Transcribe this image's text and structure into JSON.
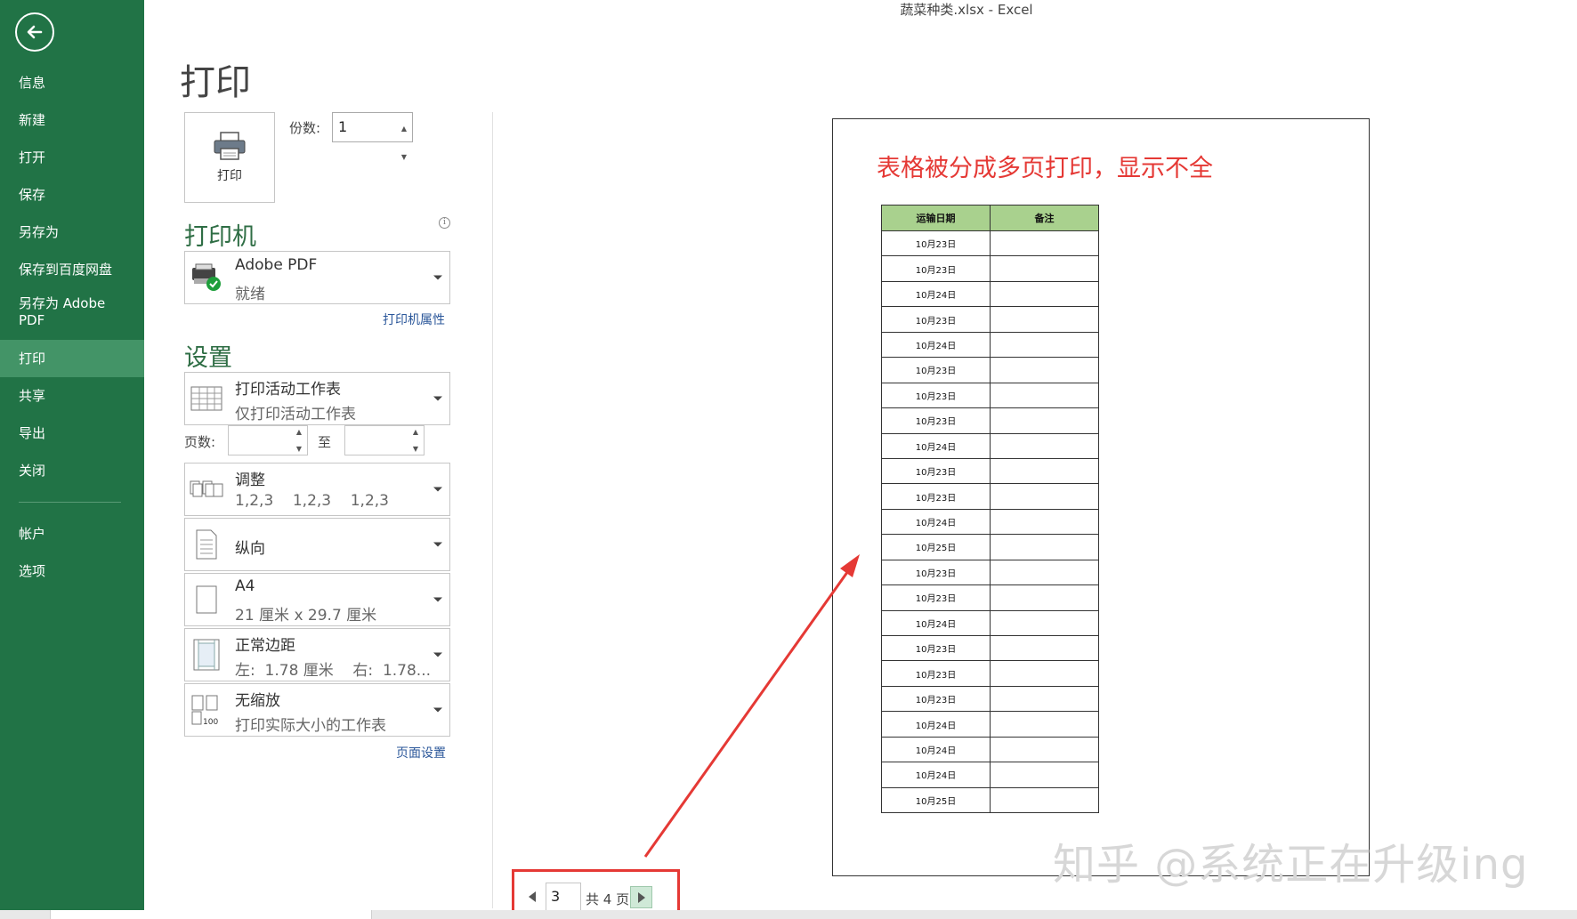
{
  "window": {
    "title": "蔬菜种类.xlsx - Excel"
  },
  "sidebar": {
    "items": [
      {
        "label": "信息"
      },
      {
        "label": "新建"
      },
      {
        "label": "打开"
      },
      {
        "label": "保存"
      },
      {
        "label": "另存为"
      },
      {
        "label": "保存到百度网盘"
      },
      {
        "label": "另存为 Adobe PDF"
      },
      {
        "label": "打印",
        "active": true
      },
      {
        "label": "共享"
      },
      {
        "label": "导出"
      },
      {
        "label": "关闭"
      }
    ],
    "bottom_items": [
      {
        "label": "帐户"
      },
      {
        "label": "选项"
      }
    ]
  },
  "print": {
    "title": "打印",
    "print_button_label": "打印",
    "copies_label": "份数:",
    "copies_value": "1",
    "printer_heading": "打印机",
    "printer_name": "Adobe PDF",
    "printer_status": "就绪",
    "printer_properties_link": "打印机属性",
    "settings_heading": "设置",
    "scope_main": "打印活动工作表",
    "scope_sub": "仅打印活动工作表",
    "pages_label": "页数:",
    "pages_to": "至",
    "collate_main": "调整",
    "collate_sub": "1,2,3    1,2,3    1,2,3",
    "orientation": "纵向",
    "paper_main": "A4",
    "paper_sub": "21 厘米 x 29.7 厘米",
    "margins_main": "正常边距",
    "margins_sub": "左:  1.78 厘米    右:  1.78...",
    "scaling_main": "无缩放",
    "scaling_sub": "打印实际大小的工作表",
    "scaling_icon_text": "100",
    "page_setup_link": "页面设置"
  },
  "preview": {
    "annotation": "表格被分成多页打印，显示不全",
    "table": {
      "headers": [
        "运输日期",
        "备注"
      ],
      "rows": [
        "10月23日",
        "10月23日",
        "10月24日",
        "10月23日",
        "10月24日",
        "10月23日",
        "10月23日",
        "10月23日",
        "10月24日",
        "10月23日",
        "10月23日",
        "10月24日",
        "10月25日",
        "10月23日",
        "10月23日",
        "10月24日",
        "10月23日",
        "10月23日",
        "10月23日",
        "10月24日",
        "10月24日",
        "10月24日",
        "10月25日"
      ]
    },
    "pager": {
      "current": "3",
      "total_text": "共 4 页"
    },
    "watermark": "知乎 @系统正在升级ing"
  },
  "colors": {
    "sidebar_bg": "#217346",
    "sidebar_active": "#439467",
    "section_heading": "#2f6e45",
    "annotation_red": "#e53935",
    "table_header_bg": "#a9d18e",
    "link": "#2b579a"
  },
  "icons": [
    "back-arrow-icon",
    "printer-icon",
    "printer-device-icon",
    "ready-check-icon",
    "sheet-icon",
    "collate-icon",
    "portrait-icon",
    "paper-icon",
    "margins-icon",
    "scaling-icon",
    "caret-down-icon",
    "info-icon",
    "prev-page-icon",
    "next-page-icon"
  ]
}
